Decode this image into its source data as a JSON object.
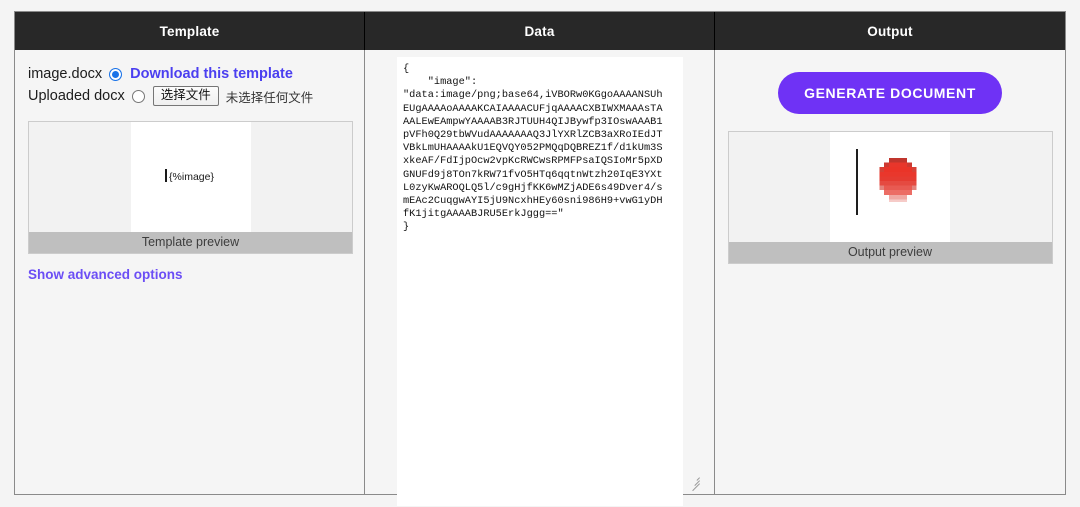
{
  "panels": {
    "template_title": "Template",
    "data_title": "Data",
    "output_title": "Output"
  },
  "template": {
    "template_file_label": "image.docx",
    "download_link": "Download this template",
    "uploaded_label": "Uploaded docx",
    "file_button": "选择文件",
    "file_status": "未选择任何文件",
    "preview_doc_text": "{%image}",
    "preview_caption": "Template preview",
    "advanced_link": "Show advanced options",
    "template_radio_selected": true,
    "upload_radio_selected": false
  },
  "data": {
    "json_text": "{\n    \"image\":\n\"data:image/png;base64,iVBORw0KGgoAAAANSUh\nEUgAAAAoAAAAKCAIAAAACUFjqAAAACXBIWXMAAAsTA\nAALEwEAmpwYAAAAB3RJTUUH4QIJBywfp3IOswAAAB1\npVFh0Q29tbWVudAAAAAAAQ3JlYXRlZCB3aXRoIEdJT\nVBkLmUHAAAAkU1EQVQY052PMQqDQBREZ1f/d1kUm3S\nxkeAF/FdIjpOcw2vpKcRWCwsRPMFPsaIQSIoMr5pXD\nGNUFd9j8TOn7kRW71fvO5HTq6qqtnWtzh20IqE3YXt\nL0zyKwAROQLQ5l/c9gHjfKK6wMZjADE6s49Dver4/s\nmEAc2CuqgwAYI5jU9NcxhHEy60sni986H9+vwG1yDH\nfK1jitgAAAABJRU5ErkJggg==\"\n}",
    "resize_handle": "textarea-resize-grip"
  },
  "output": {
    "generate_button": "GENERATE DOCUMENT",
    "preview_caption": "Output preview",
    "preview_image_alt": "red-apple-pixel-image"
  },
  "colors": {
    "header_bg": "#282828",
    "page_bg": "#f4f4f4",
    "panel_bg": "#f5f5f5",
    "accent_purple": "#6f32f5",
    "link_purple": "#4b3ff0",
    "radio_blue": "#1a73e8",
    "caption_bg": "#bfbfbf",
    "blob_red": "#e03b30"
  }
}
